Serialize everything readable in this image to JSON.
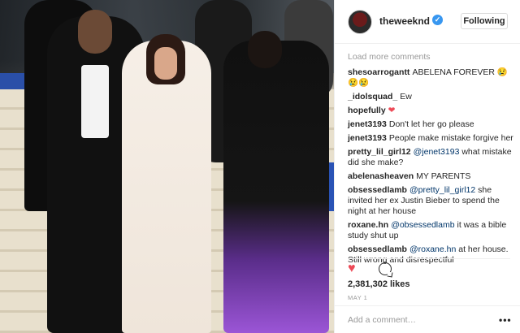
{
  "post": {
    "username": "theweeknd",
    "verified_icon": "verified-badge-icon",
    "follow_button": "Following",
    "load_more": "Load more comments",
    "comments": [
      {
        "user": "shesoarrogantt",
        "text": "ABELENA FOREVER ",
        "emoji": "😢😢😢"
      },
      {
        "user": "_idolsquad_",
        "text": "Ew"
      },
      {
        "user": "hopefully",
        "text": "",
        "emoji": "❤"
      },
      {
        "user": "jenet3193",
        "text": "Don't let her go please"
      },
      {
        "user": "jenet3193",
        "text": "People make mistake forgive her"
      },
      {
        "user": "pretty_lil_girl12",
        "mention": "@jenet3193",
        "text": " what mistake did she make?"
      },
      {
        "user": "abelenasheaven",
        "text": "MY PARENTS"
      },
      {
        "user": "obsessedlamb",
        "mention": "@pretty_lil_girl12",
        "text": " she invited her ex Justin Bieber to spend the night at her house"
      },
      {
        "user": "roxane.hn",
        "mention": "@obsessedlamb",
        "text": " it was a bible study shut up"
      },
      {
        "user": "obsessedlamb",
        "mention": "@roxane.hn",
        "text": " at her house. Still wrong and disrespectful"
      }
    ],
    "likes": "2,381,302 likes",
    "date": "MAY 1",
    "add_comment_placeholder": "Add a comment…",
    "more_options": "•••"
  },
  "colors": {
    "verified": "#3897f0",
    "like": "#ed4956",
    "mention": "#003569",
    "muted": "#999999"
  }
}
